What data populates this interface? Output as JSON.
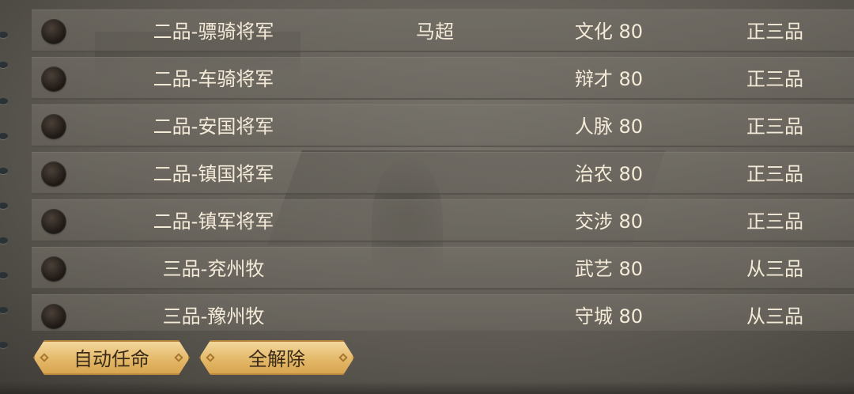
{
  "rows": [
    {
      "title": "二品-骠骑将军",
      "person": "马超",
      "attr": "文化 80",
      "rank": "正三品"
    },
    {
      "title": "二品-车骑将军",
      "person": "",
      "attr": "辩才 80",
      "rank": "正三品"
    },
    {
      "title": "二品-安国将军",
      "person": "",
      "attr": "人脉 80",
      "rank": "正三品"
    },
    {
      "title": "二品-镇国将军",
      "person": "",
      "attr": "治农 80",
      "rank": "正三品"
    },
    {
      "title": "二品-镇军将军",
      "person": "",
      "attr": "交涉 80",
      "rank": "正三品"
    },
    {
      "title": "三品-兖州牧",
      "person": "",
      "attr": "武艺 80",
      "rank": "从三品"
    },
    {
      "title": "三品-豫州牧",
      "person": "",
      "attr": "守城 80",
      "rank": "从三品"
    }
  ],
  "buttons": {
    "auto_appoint": "自动任命",
    "clear_all": "全解除"
  }
}
